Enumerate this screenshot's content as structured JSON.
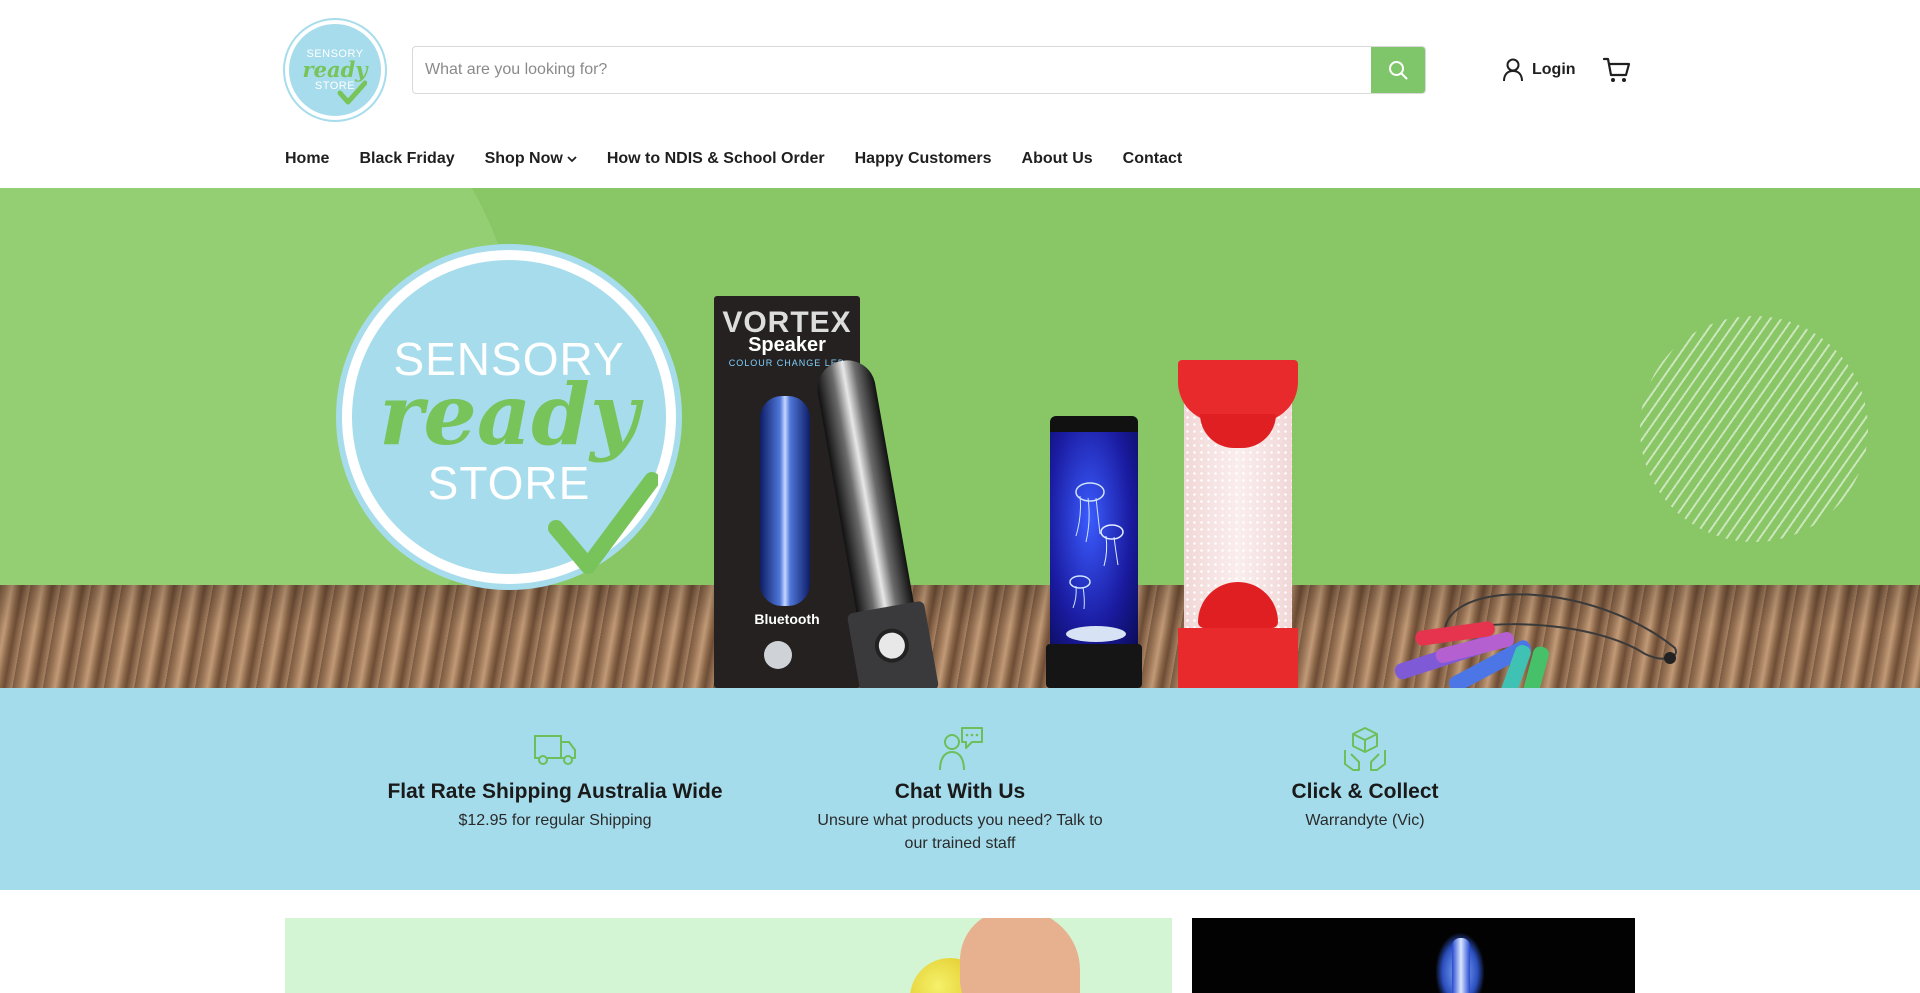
{
  "header": {
    "logo": {
      "line1": "SENSORY",
      "line2": "ready",
      "line3": "STORE"
    },
    "search": {
      "placeholder": "What are you looking for?",
      "value": ""
    },
    "login_label": "Login",
    "nav": [
      {
        "label": "Home"
      },
      {
        "label": "Black Friday"
      },
      {
        "label": "Shop Now"
      },
      {
        "label": "How to NDIS & School Order"
      },
      {
        "label": "Happy Customers"
      },
      {
        "label": "About Us"
      },
      {
        "label": "Contact"
      }
    ]
  },
  "hero": {
    "logo": {
      "line1": "SENSORY",
      "line2": "ready",
      "line3": "STORE"
    },
    "speaker_box": {
      "brand": "VORTEX",
      "name": "Speaker",
      "tagline": "COLOUR CHANGE LED",
      "bluetooth": "Bluetooth"
    }
  },
  "features": [
    {
      "icon": "truck-icon",
      "title": "Flat Rate Shipping Australia Wide",
      "text": "$12.95 for regular Shipping"
    },
    {
      "icon": "chat-support-icon",
      "title": "Chat With Us",
      "text": "Unsure what products you need? Talk to our trained staff"
    },
    {
      "icon": "package-hands-icon",
      "title": "Click & Collect",
      "text": "Warrandyte (Vic)"
    }
  ],
  "colors": {
    "accent_green": "#7fc66b",
    "hero_green": "#89c766",
    "feature_band_blue": "#a4dcec",
    "logo_blue": "#a6dcec"
  }
}
